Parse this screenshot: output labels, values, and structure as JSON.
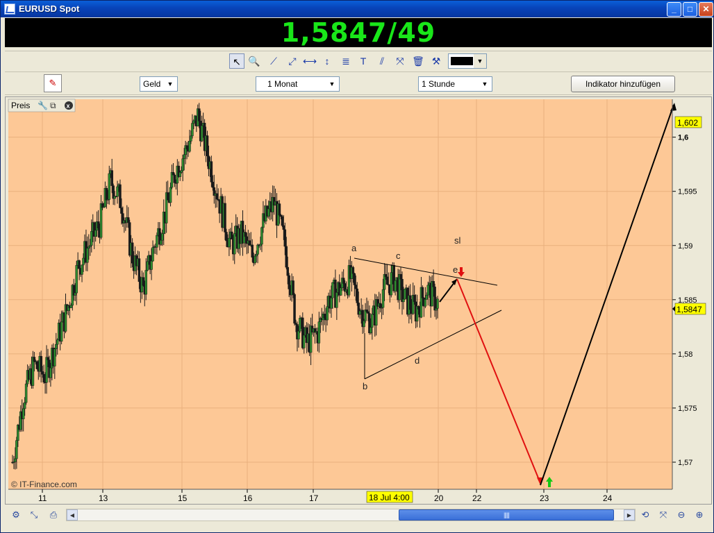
{
  "window": {
    "title": "EURUSD Spot"
  },
  "quote": {
    "value": "1,5847/49",
    "color": "#19e619"
  },
  "toolbar": {
    "tools": [
      "pointer-icon",
      "zoom-icon",
      "trendline-icon",
      "ray-icon",
      "horizontal-line-icon",
      "vertical-line-icon",
      "fibonacci-icon",
      "text-icon",
      "channel-icon",
      "pitchfork-icon",
      "trash-icon",
      "tools-icon"
    ],
    "line_color": "#000000"
  },
  "controls": {
    "price_type": "Geld",
    "period": "1 Monat",
    "interval": "1 Stunde",
    "add_indicator": "Indikator hinzufügen"
  },
  "chart": {
    "panel_label": "Preis",
    "watermark": "© IT-Finance.com",
    "background": "#fdc896",
    "y_ticks": [
      "1,6",
      "1,595",
      "1,59",
      "1,585",
      "1,58",
      "1,575",
      "1,57"
    ],
    "x_ticks": [
      "11",
      "13",
      "15",
      "16",
      "17",
      "20",
      "22",
      "23",
      "24"
    ],
    "cursor_x_label": "18 Jul 4:00",
    "current_price_label": "1,5847",
    "target_price_label": "1,602",
    "wave_labels": [
      "a",
      "b",
      "c",
      "d",
      "e"
    ],
    "sl_label": "sl"
  },
  "chart_data": {
    "type": "candlestick",
    "instrument": "EURUSD Spot",
    "interval": "1 Stunde",
    "period": "1 Monat",
    "x_ticks": [
      "11",
      "13",
      "15",
      "16",
      "17",
      "18 Jul 4:00",
      "20",
      "22",
      "23",
      "24"
    ],
    "ylim": [
      1.5675,
      1.6035
    ],
    "y_ticks": [
      1.6,
      1.595,
      1.59,
      1.585,
      1.58,
      1.575,
      1.57
    ],
    "current_price": 1.5847,
    "target_price": 1.602,
    "low_projection": 1.569,
    "price_path_closes": [
      1.57,
      1.576,
      1.579,
      1.578,
      1.581,
      1.584,
      1.588,
      1.59,
      1.592,
      1.596,
      1.594,
      1.589,
      1.586,
      1.59,
      1.593,
      1.597,
      1.599,
      1.602,
      1.598,
      1.594,
      1.59,
      1.591,
      1.589,
      1.592,
      1.594,
      1.59,
      1.583,
      1.581,
      1.582,
      1.585,
      1.586,
      1.587,
      1.584,
      1.583,
      1.586,
      1.587,
      1.585,
      1.584,
      1.586,
      1.5847
    ],
    "triangle": {
      "upper_line": [
        [
          1.5895,
          "a"
        ],
        [
          1.5872,
          "end"
        ]
      ],
      "lower_line": [
        [
          1.578,
          "b"
        ],
        [
          1.5852,
          "end"
        ]
      ]
    },
    "annotations": [
      "a",
      "b",
      "c",
      "d",
      "e",
      "sl"
    ],
    "grid": true
  }
}
